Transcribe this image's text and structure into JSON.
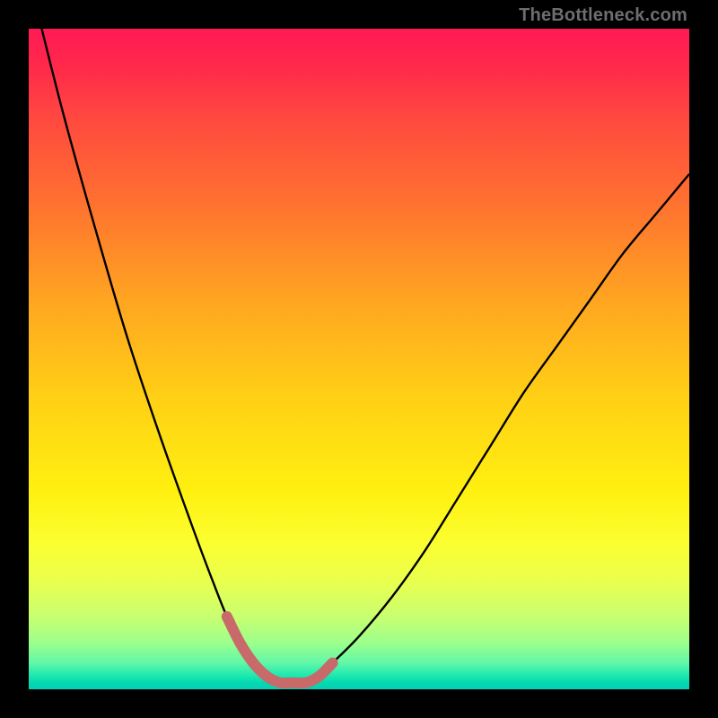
{
  "credit": "TheBottleneck.com",
  "colors": {
    "frame": "#000000",
    "gradient_top": "#ff1a55",
    "gradient_bottom": "#05d0b5",
    "curve_stroke": "#000000",
    "highlight_stroke": "#c86a6a"
  },
  "chart_data": {
    "type": "line",
    "title": "",
    "xlabel": "",
    "ylabel": "",
    "xlim": [
      0,
      100
    ],
    "ylim": [
      0,
      100
    ],
    "series": [
      {
        "name": "bottleneck_curve",
        "x": [
          0,
          5,
          10,
          15,
          20,
          25,
          28,
          30,
          32,
          34,
          36,
          38,
          40,
          42,
          44,
          46,
          50,
          55,
          60,
          65,
          70,
          75,
          80,
          85,
          90,
          95,
          100
        ],
        "y": [
          108,
          88,
          70,
          53,
          38,
          24,
          16,
          11,
          7,
          4,
          2,
          1,
          1,
          1,
          2,
          4,
          8,
          14,
          21,
          29,
          37,
          45,
          52,
          59,
          66,
          72,
          78
        ]
      }
    ],
    "highlight": {
      "x_range": [
        30,
        46
      ],
      "meaning": "optimal_zone"
    }
  }
}
